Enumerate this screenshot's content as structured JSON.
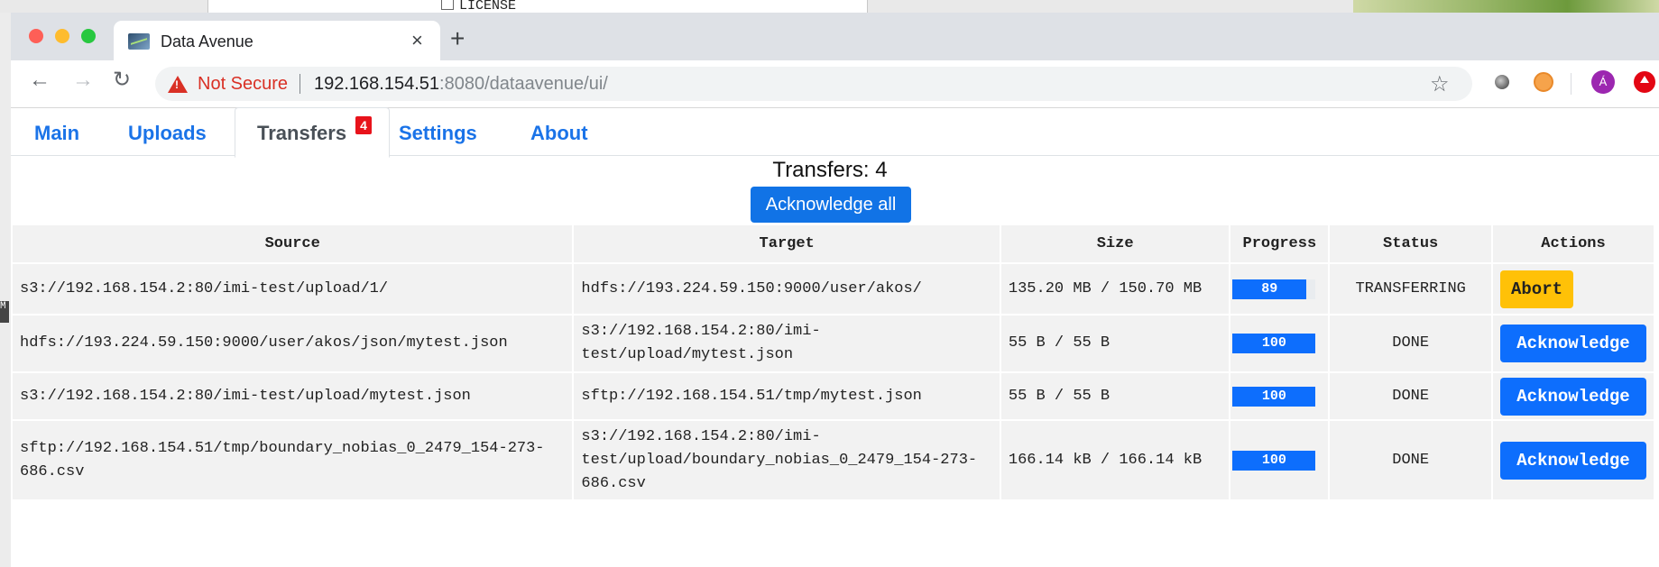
{
  "background": {
    "license_text": "LICENSE",
    "left_mark": "M"
  },
  "browser": {
    "tab_title": "Data Avenue",
    "close_glyph": "×",
    "new_tab_glyph": "+",
    "security_label": "Not Secure",
    "url_host": "192.168.154.51",
    "url_rest": ":8080/dataavenue/ui/",
    "profile_initial": "Á"
  },
  "nav": {
    "main": "Main",
    "uploads": "Uploads",
    "transfers": "Transfers",
    "transfers_badge": "4",
    "settings": "Settings",
    "about": "About"
  },
  "transfers_count_label": "Transfers: 4",
  "acknowledge_all_label": "Acknowledge all",
  "table": {
    "headers": [
      "Source",
      "Target",
      "Size",
      "Progress",
      "Status",
      "Actions"
    ],
    "rows": [
      {
        "source": "s3://192.168.154.2:80/imi-test/upload/1/",
        "target": "hdfs://193.224.59.150:9000/user/akos/",
        "size": "135.20 MB / 150.70 MB",
        "progress": 89,
        "progress_label": "89",
        "status": "TRANSFERRING",
        "action": "Abort"
      },
      {
        "source": "hdfs://193.224.59.150:9000/user/akos/json/mytest.json",
        "target": "s3://192.168.154.2:80/imi-test/upload/mytest.json",
        "size": "55 B / 55 B",
        "progress": 100,
        "progress_label": "100",
        "status": "DONE",
        "action": "Acknowledge"
      },
      {
        "source": "s3://192.168.154.2:80/imi-test/upload/mytest.json",
        "target": "sftp://192.168.154.51/tmp/mytest.json",
        "size": "55 B / 55 B",
        "progress": 100,
        "progress_label": "100",
        "status": "DONE",
        "action": "Acknowledge"
      },
      {
        "source": "sftp://192.168.154.51/tmp/boundary_nobias_0_2479_154-273-686.csv",
        "target": "s3://192.168.154.2:80/imi-test/upload/boundary_nobias_0_2479_154-273-686.csv",
        "size": "166.14 kB / 166.14 kB",
        "progress": 100,
        "progress_label": "100",
        "status": "DONE",
        "action": "Acknowledge"
      }
    ]
  },
  "colors": {
    "primary": "#0d6efd",
    "warning": "#ffc107",
    "badge": "#e8131b",
    "not_secure": "#d93025"
  }
}
